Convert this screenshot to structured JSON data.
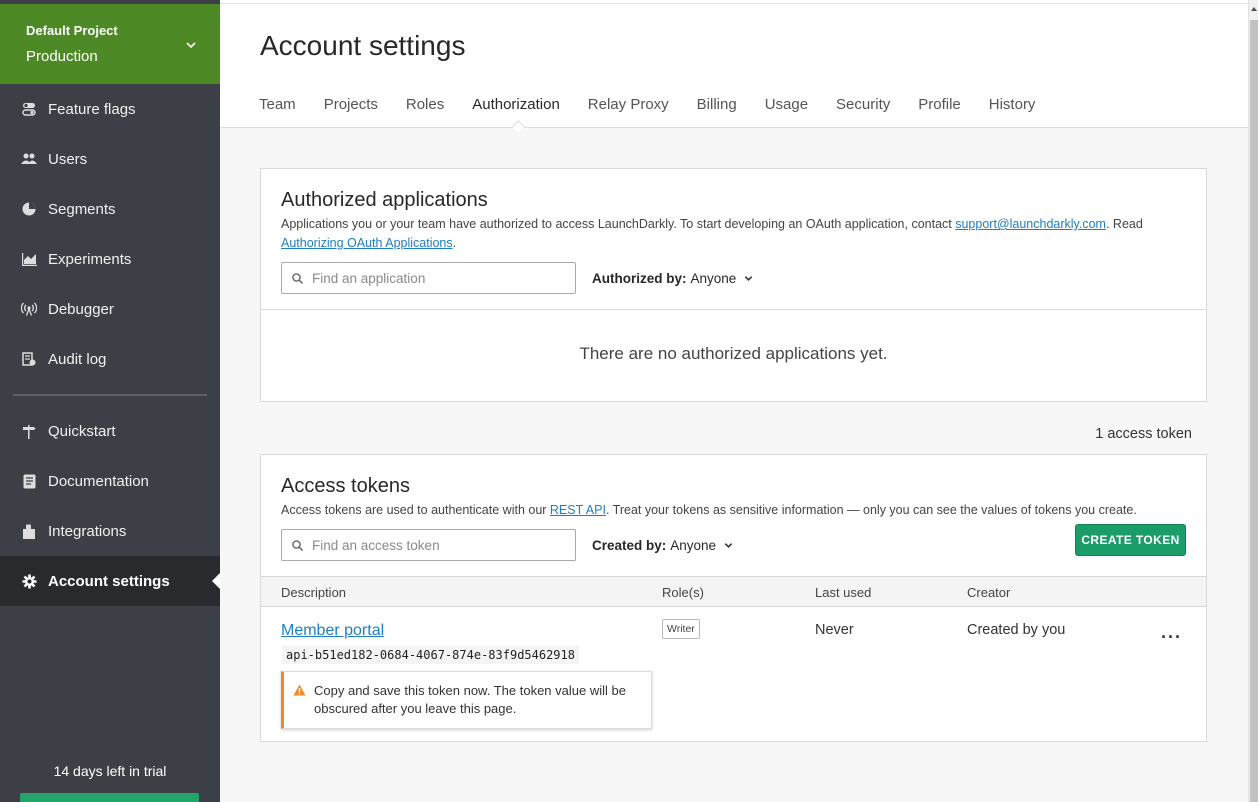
{
  "sidebar": {
    "project_name": "Default Project",
    "environment": "Production",
    "items": [
      {
        "label": "Feature flags",
        "icon": "toggle-icon"
      },
      {
        "label": "Users",
        "icon": "users-icon"
      },
      {
        "label": "Segments",
        "icon": "pie-icon"
      },
      {
        "label": "Experiments",
        "icon": "chart-icon"
      },
      {
        "label": "Debugger",
        "icon": "broadcast-icon"
      },
      {
        "label": "Audit log",
        "icon": "audit-icon"
      },
      {
        "label": "Quickstart",
        "icon": "signpost-icon"
      },
      {
        "label": "Documentation",
        "icon": "document-icon"
      },
      {
        "label": "Integrations",
        "icon": "puzzle-icon"
      },
      {
        "label": "Account settings",
        "icon": "gear-icon"
      }
    ],
    "trial_text": "14 days left in trial"
  },
  "header": {
    "title": "Account settings",
    "tabs": [
      {
        "label": "Team"
      },
      {
        "label": "Projects"
      },
      {
        "label": "Roles"
      },
      {
        "label": "Authorization",
        "active": true
      },
      {
        "label": "Relay Proxy"
      },
      {
        "label": "Billing"
      },
      {
        "label": "Usage"
      },
      {
        "label": "Security"
      },
      {
        "label": "Profile"
      },
      {
        "label": "History"
      }
    ]
  },
  "authorized_apps": {
    "title": "Authorized applications",
    "desc_prefix": "Applications you or your team have authorized to access LaunchDarkly. To start developing an OAuth application, contact ",
    "desc_email": "support@launchdarkly.com",
    "desc_mid": ". Read",
    "desc_link": "Authorizing OAuth Applications",
    "desc_suffix": ".",
    "search_placeholder": "Find an application",
    "filter_label": "Authorized by:",
    "filter_value": "Anyone",
    "empty_text": "There are no authorized applications yet."
  },
  "token_count": "1 access token",
  "access_tokens": {
    "title": "Access tokens",
    "desc_prefix": "Access tokens are used to authenticate with our ",
    "desc_link": "REST API",
    "desc_suffix": ". Treat your tokens as sensitive information — only you can see the values of tokens you create.",
    "search_placeholder": "Find an access token",
    "filter_label": "Created by:",
    "filter_value": "Anyone",
    "create_label": "CREATE TOKEN",
    "columns": [
      "Description",
      "Role(s)",
      "Last used",
      "Creator"
    ],
    "rows": [
      {
        "name": "Member portal",
        "token": "api-b51ed182-0684-4067-874e-83f9d5462918",
        "role": "Writer",
        "last_used": "Never",
        "creator": "Created by you",
        "more": "···"
      }
    ],
    "warning": "Copy and save this token now. The token value will be obscured after you leave this page."
  },
  "colors": {
    "accent_green": "#4d8a26",
    "create_button": "#1a9d68",
    "link_blue": "#1e7fc2",
    "warning_orange": "#f08a24"
  }
}
